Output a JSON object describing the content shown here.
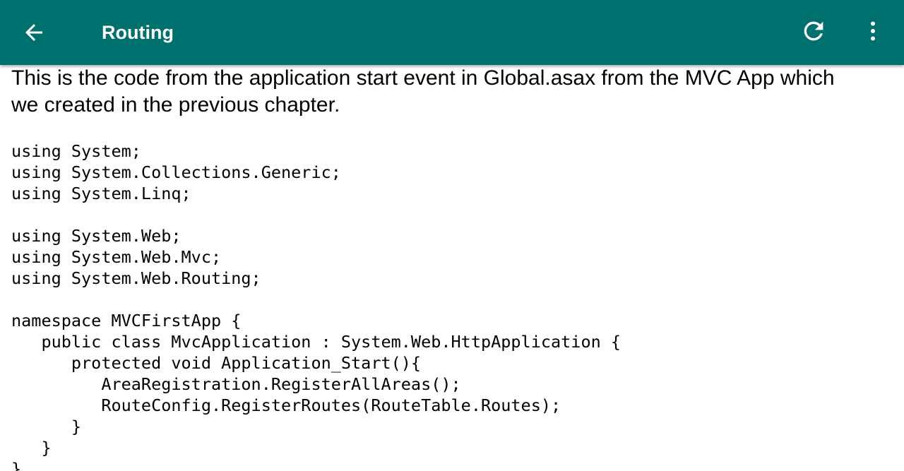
{
  "appbar": {
    "title": "Routing",
    "background_color": "#00706f",
    "back_icon": "arrow-left-icon",
    "refresh_icon": "refresh-icon",
    "menu_icon": "more-vertical-icon"
  },
  "content": {
    "intro_lines": [
      "This is the code from the application start event in Global.asax from the MVC App which",
      "we created in the previous chapter."
    ],
    "code_lines": [
      "using System;",
      "using System.Collections.Generic;",
      "using System.Linq;",
      "",
      "using System.Web;",
      "using System.Web.Mvc;",
      "using System.Web.Routing;",
      "",
      "namespace MVCFirstApp {",
      "   public class MvcApplication : System.Web.HttpApplication {",
      "      protected void Application_Start(){",
      "         AreaRegistration.RegisterAllAreas();",
      "         RouteConfig.RegisterRoutes(RouteTable.Routes);",
      "      }",
      "   }",
      "}"
    ]
  }
}
